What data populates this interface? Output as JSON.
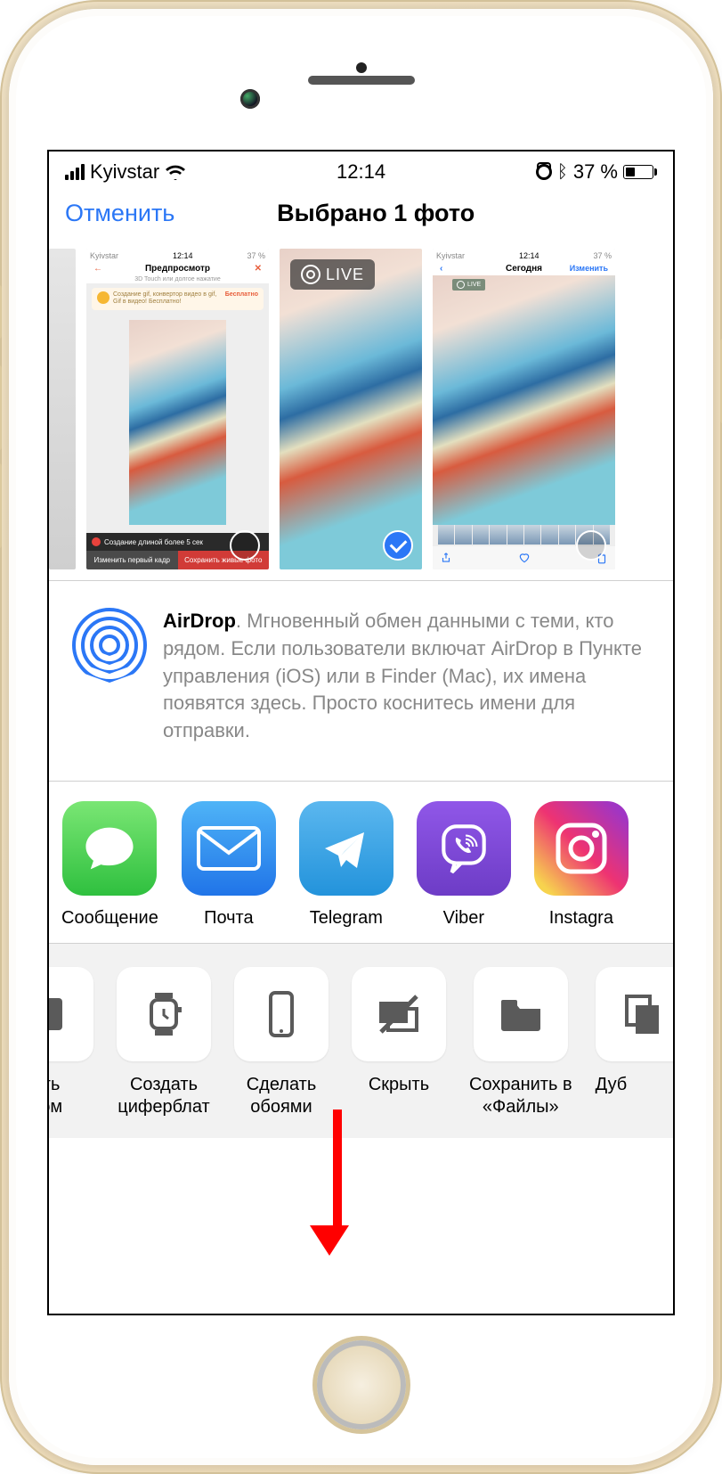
{
  "status": {
    "carrier": "Kyivstar",
    "time": "12:14",
    "battery_text": "37 %",
    "bluetooth_glyph": "✽"
  },
  "nav": {
    "cancel": "Отменить",
    "title": "Выбрано 1 фото"
  },
  "thumbs": {
    "t1": {
      "status_left": "Kyivstar",
      "status_time": "12:14",
      "status_right": "37 %",
      "title": "Предпросмотр",
      "subtitle": "3D Touch или долгое нажатие",
      "banner_text": "Создание gif, конвертор видео в gif, Gif в видео! Бесплатно!",
      "banner_tag": "Бесплатно",
      "strip": "Создание длиной более 5 сек",
      "btn1": "Изменить первый кадр",
      "btn2": "Сохранить живые фото"
    },
    "t2": {
      "live_label": "LIVE"
    },
    "t3": {
      "status_left": "Kyivstar",
      "status_time": "12:14",
      "status_right": "37 %",
      "back": "‹",
      "title": "Сегодня",
      "edit": "Изменить",
      "live_badge": "LIVE"
    }
  },
  "airdrop": {
    "bold": "AirDrop",
    "text": ". Мгновенный обмен данными с теми, кто рядом. Если пользователи включат AirDrop в Пункте управления (iOS) или в Finder (Mac), их имена появятся здесь. Просто коснитесь имени для отправки."
  },
  "apps": {
    "msg": "Сообщение",
    "mail": "Почта",
    "tg": "Telegram",
    "vbr": "Viber",
    "ig": "Instagra"
  },
  "actions": {
    "cut_left": "ить\nбом",
    "watch": "Создать\nциферблат",
    "wallpaper": "Сделать\nобоями",
    "hide": "Скрыть",
    "files": "Сохранить в\n«Файлы»",
    "dup": "Дуб"
  }
}
